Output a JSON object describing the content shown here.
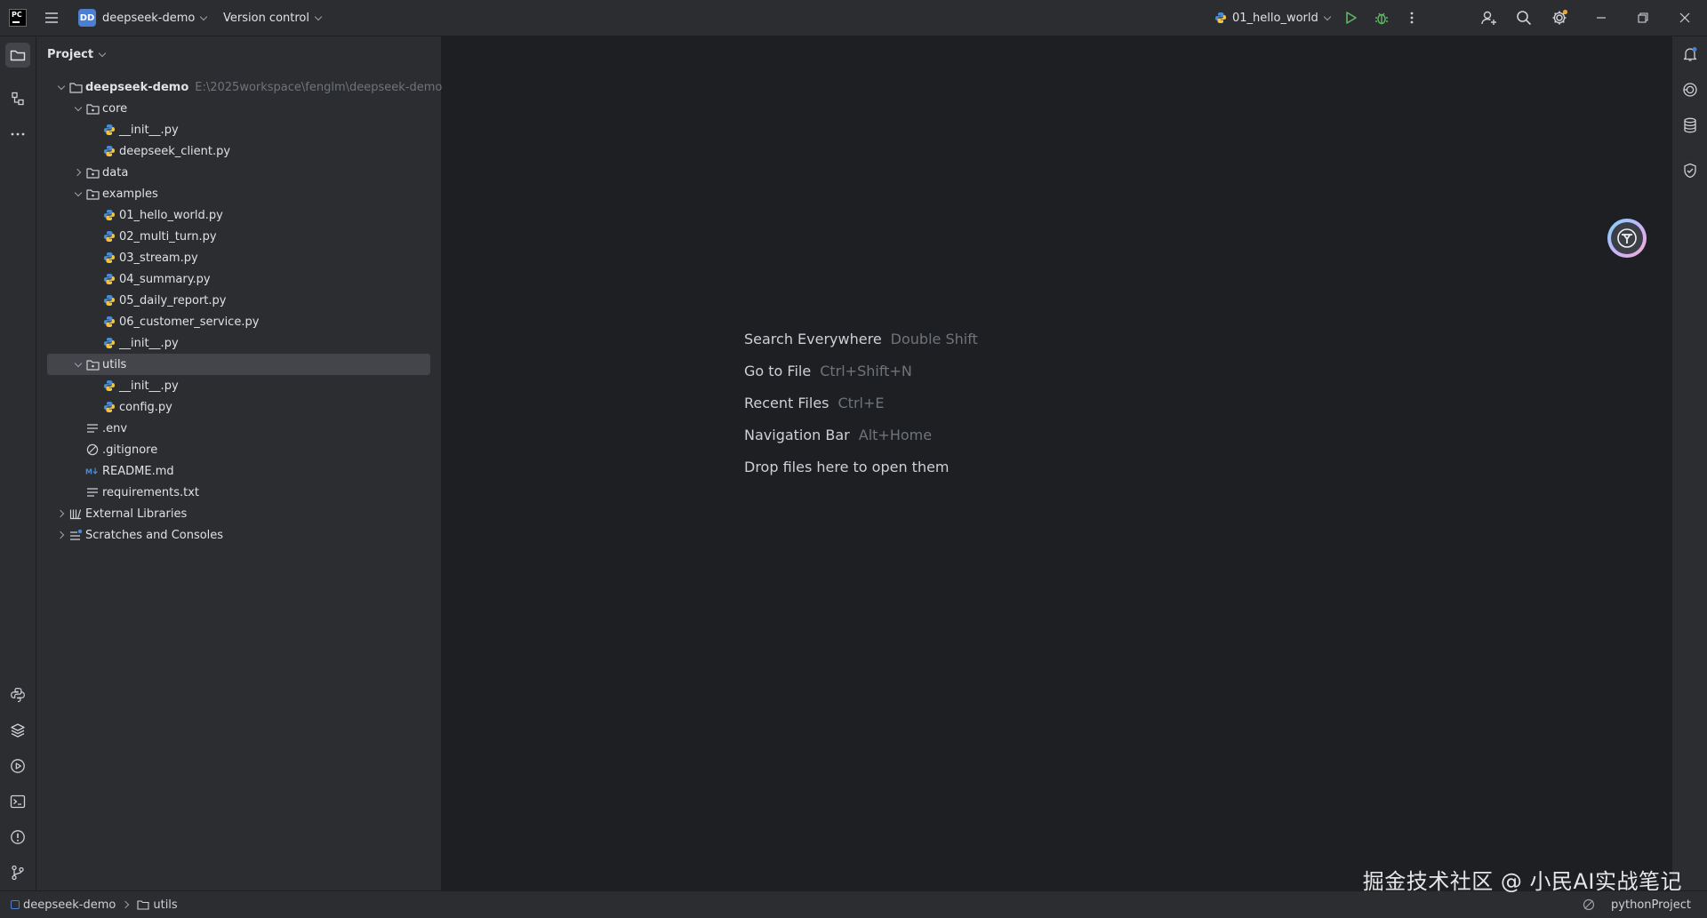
{
  "titlebar": {
    "app_logo_text": "PC",
    "project_badge": "DD",
    "project_name": "deepseek-demo",
    "vcs_label": "Version control",
    "run_config": "01_hello_world"
  },
  "project_panel": {
    "title": "Project",
    "tree": [
      {
        "label": "deepseek-demo",
        "hint": "E:\\2025workspace\\fenglm\\deepseek-demo",
        "depth": 0,
        "arrow": "open",
        "icon": "folder-icon",
        "bold": true
      },
      {
        "label": "core",
        "depth": 1,
        "arrow": "open",
        "icon": "package-folder-icon"
      },
      {
        "label": "__init__.py",
        "depth": 2,
        "arrow": "none",
        "icon": "python-file-icon"
      },
      {
        "label": "deepseek_client.py",
        "depth": 2,
        "arrow": "none",
        "icon": "python-file-icon"
      },
      {
        "label": "data",
        "depth": 1,
        "arrow": "closed",
        "icon": "package-folder-icon"
      },
      {
        "label": "examples",
        "depth": 1,
        "arrow": "open",
        "icon": "package-folder-icon"
      },
      {
        "label": "01_hello_world.py",
        "depth": 2,
        "arrow": "none",
        "icon": "python-file-icon"
      },
      {
        "label": "02_multi_turn.py",
        "depth": 2,
        "arrow": "none",
        "icon": "python-file-icon"
      },
      {
        "label": "03_stream.py",
        "depth": 2,
        "arrow": "none",
        "icon": "python-file-icon"
      },
      {
        "label": "04_summary.py",
        "depth": 2,
        "arrow": "none",
        "icon": "python-file-icon"
      },
      {
        "label": "05_daily_report.py",
        "depth": 2,
        "arrow": "none",
        "icon": "python-file-icon"
      },
      {
        "label": "06_customer_service.py",
        "depth": 2,
        "arrow": "none",
        "icon": "python-file-icon"
      },
      {
        "label": "__init__.py",
        "depth": 2,
        "arrow": "none",
        "icon": "python-file-icon"
      },
      {
        "label": "utils",
        "depth": 1,
        "arrow": "open",
        "icon": "package-folder-icon",
        "selected": true
      },
      {
        "label": "__init__.py",
        "depth": 2,
        "arrow": "none",
        "icon": "python-file-icon"
      },
      {
        "label": "config.py",
        "depth": 2,
        "arrow": "none",
        "icon": "python-file-icon"
      },
      {
        "label": ".env",
        "depth": 1,
        "arrow": "none",
        "icon": "text-file-icon"
      },
      {
        "label": ".gitignore",
        "depth": 1,
        "arrow": "none",
        "icon": "ignore-file-icon"
      },
      {
        "label": "README.md",
        "depth": 1,
        "arrow": "none",
        "icon": "markdown-file-icon"
      },
      {
        "label": "requirements.txt",
        "depth": 1,
        "arrow": "none",
        "icon": "text-file-icon"
      },
      {
        "label": "External Libraries",
        "depth": 0,
        "arrow": "closed",
        "icon": "library-icon"
      },
      {
        "label": "Scratches and Consoles",
        "depth": 0,
        "arrow": "closed",
        "icon": "scratches-icon"
      }
    ]
  },
  "editor": {
    "hints": [
      {
        "label": "Search Everywhere",
        "shortcut": "Double Shift"
      },
      {
        "label": "Go to File",
        "shortcut": "Ctrl+Shift+N"
      },
      {
        "label": "Recent Files",
        "shortcut": "Ctrl+E"
      },
      {
        "label": "Navigation Bar",
        "shortcut": "Alt+Home"
      },
      {
        "label": "Drop files here to open them",
        "shortcut": ""
      }
    ]
  },
  "statusbar": {
    "breadcrumb_project": "deepseek-demo",
    "breadcrumb_folder": "utils",
    "interpreter": "pythonProject"
  },
  "watermark": "掘金技术社区 @ 小民AI实战笔记",
  "colors": {
    "background": "#1e1f22",
    "panel": "#2b2d30",
    "selection": "#43454a",
    "accent": "#4a7fd4",
    "run_green": "#5fb865"
  }
}
